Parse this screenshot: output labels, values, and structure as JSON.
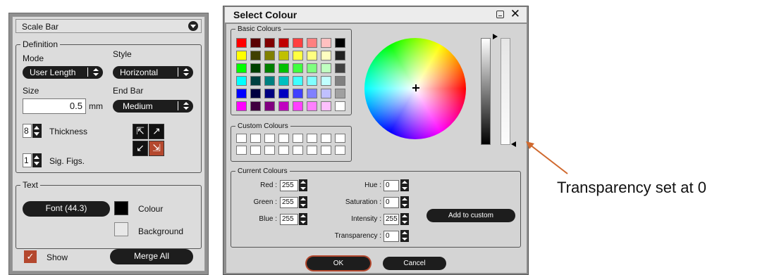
{
  "scale_bar": {
    "title": "Scale Bar",
    "definition_legend": "Definition",
    "mode_label": "Mode",
    "mode_value": "User Length",
    "style_label": "Style",
    "style_value": "Horizontal",
    "size_label": "Size",
    "size_value": "0.5",
    "size_unit": "mm",
    "end_bar_label": "End Bar",
    "end_bar_value": "Medium",
    "thickness_value": "8",
    "thickness_label": "Thickness",
    "sig_figs_value": "1",
    "sig_figs_label": "Sig. Figs.",
    "text_legend": "Text",
    "font_button": "Font (44.3)",
    "colour_label": "Colour",
    "background_label": "Background",
    "show_label": "Show",
    "merge_all_button": "Merge All"
  },
  "select_colour": {
    "title": "Select Colour",
    "basic_colours_legend": "Basic Colours",
    "basic_colours": [
      [
        "#ff0000",
        "#5a0000",
        "#800000",
        "#c00000",
        "#ff4040",
        "#ff8080",
        "#ffc0c0",
        "#000000"
      ],
      [
        "#ffff00",
        "#404000",
        "#808000",
        "#c0c000",
        "#ffff40",
        "#ffff80",
        "#ffffc0",
        "#202020"
      ],
      [
        "#00ff00",
        "#004000",
        "#008000",
        "#00c000",
        "#40ff40",
        "#80ff80",
        "#c0ffc0",
        "#404040"
      ],
      [
        "#00ffff",
        "#004040",
        "#008080",
        "#00c0c0",
        "#40ffff",
        "#80ffff",
        "#c0ffff",
        "#808080"
      ],
      [
        "#0000ff",
        "#000040",
        "#000080",
        "#0000c0",
        "#4040ff",
        "#8080ff",
        "#c0c0ff",
        "#a0a0a0"
      ],
      [
        "#ff00ff",
        "#400040",
        "#800080",
        "#c000c0",
        "#ff40ff",
        "#ff80ff",
        "#ffc0ff",
        "#ffffff"
      ]
    ],
    "custom_colours_legend": "Custom Colours",
    "current_colours_legend": "Current Colours",
    "red_label": "Red :",
    "red_value": "255",
    "green_label": "Green :",
    "green_value": "255",
    "blue_label": "Blue :",
    "blue_value": "255",
    "hue_label": "Hue :",
    "hue_value": "0",
    "saturation_label": "Saturation :",
    "saturation_value": "0",
    "intensity_label": "Intensity :",
    "intensity_value": "255",
    "transparency_label": "Transparency :",
    "transparency_value": "0",
    "add_to_custom_button": "Add to custom",
    "ok_button": "OK",
    "cancel_button": "Cancel"
  },
  "annotation": {
    "text": "Transparency set at 0",
    "arrow_color": "#d0692e"
  },
  "colors": {
    "accent": "#b4482e",
    "dark_button": "#1d1d1d",
    "panel_bg": "#dcdcdc",
    "dialog_bg": "#d4d4d4"
  }
}
